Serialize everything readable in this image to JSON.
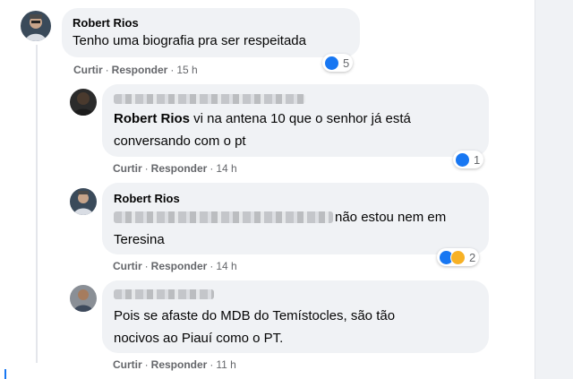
{
  "comments": [
    {
      "author": "Robert Rios",
      "text": "Tenho uma biografia pra ser respeitada",
      "actions": {
        "like": "Curtir",
        "reply": "Responder",
        "time": "15 h"
      },
      "reactions": {
        "icons": [
          "like-icon"
        ],
        "count": "5"
      }
    },
    {
      "author_blurred": true,
      "mention": "Robert Rios",
      "text_after_mention": " vi na antena 10 que o senhor já está",
      "text_line2": "conversando com o pt",
      "actions": {
        "like": "Curtir",
        "reply": "Responder",
        "time": "14 h"
      },
      "reactions": {
        "icons": [
          "like-icon"
        ],
        "count": "1"
      }
    },
    {
      "author": "Robert Rios",
      "text_line1_visible": "não estou nem em",
      "text_line2": "Teresina",
      "actions": {
        "like": "Curtir",
        "reply": "Responder",
        "time": "14 h"
      },
      "reactions": {
        "icons": [
          "like-icon",
          "haha-icon"
        ],
        "count": "2"
      }
    },
    {
      "author_blurred": true,
      "text_line1": "Pois se afaste do MDB do Temístocles, são tão",
      "text_line2": "nocivos ao Piauí como o PT.",
      "actions": {
        "like": "Curtir",
        "reply": "Responder",
        "time": "11 h"
      }
    }
  ],
  "separator": "·",
  "colors": {
    "bubble": "#f0f2f5",
    "link_blue": "#1877f2",
    "meta_gray": "#65676b"
  }
}
